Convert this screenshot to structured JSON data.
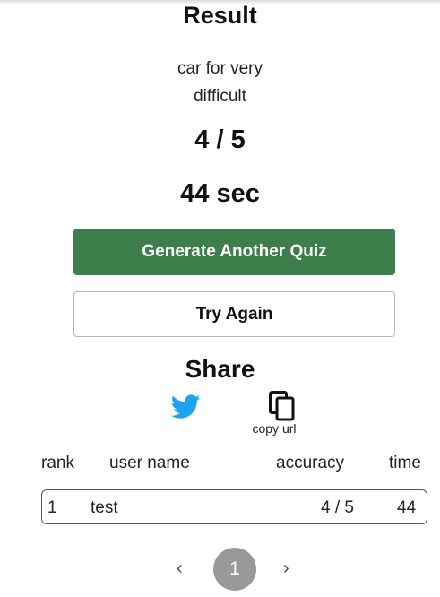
{
  "result": {
    "title": "Result",
    "quiz_name_line1": "car for very",
    "quiz_name_line2": "difficult",
    "score": "4 / 5",
    "time": "44 sec"
  },
  "actions": {
    "generate_label": "Generate Another Quiz",
    "try_again_label": "Try Again"
  },
  "share": {
    "heading": "Share",
    "twitter_icon": "twitter-icon",
    "copy_icon": "copy-icon",
    "copy_label": "copy url"
  },
  "leaderboard": {
    "headers": {
      "rank": "rank",
      "user_name": "user name",
      "accuracy": "accuracy",
      "time": "time"
    },
    "rows": [
      {
        "rank": "1",
        "user_name": "test",
        "accuracy": "4 / 5",
        "time": "44"
      }
    ]
  },
  "pagination": {
    "prev_icon": "‹",
    "current_page": "1",
    "next_icon": "›"
  },
  "colors": {
    "primary_button": "#3e7e4a",
    "twitter_blue": "#1da1f2",
    "page_badge": "#999999"
  }
}
